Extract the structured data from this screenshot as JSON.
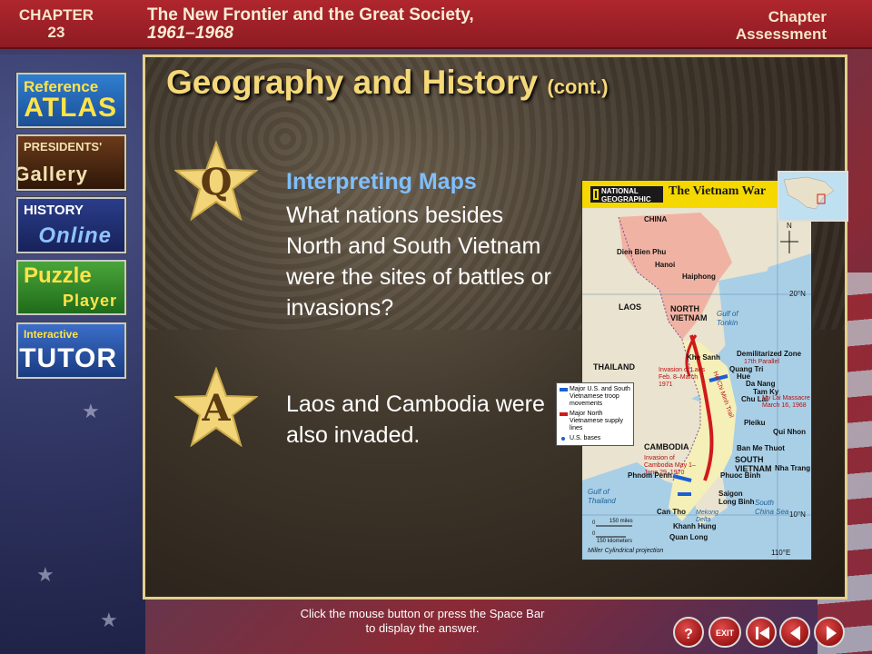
{
  "header": {
    "chapter_label": "CHAPTER",
    "chapter_number": "23",
    "title": "The New Frontier and the Great Society,",
    "years": "1961–1968",
    "assessment_line1": "Chapter",
    "assessment_line2": "Assessment"
  },
  "nav": {
    "atlas": {
      "line1": "Reference",
      "line2": "ATLAS"
    },
    "presidents": {
      "line1": "PRESIDENTS'",
      "line2": "Gallery"
    },
    "history": {
      "line1": "HISTORY",
      "line2": "Online"
    },
    "puzzle": {
      "line1": "Puzzle",
      "line2": "Player"
    },
    "tutor": {
      "line1": "Interactive",
      "line2": "TUTOR"
    }
  },
  "slide": {
    "title": "Geography and History",
    "title_suffix": "(cont.)",
    "q_letter": "Q",
    "a_letter": "A",
    "question_heading": "Interpreting Maps",
    "question_text": "What nations besides North and South Vietnam were the sites of battles or invasions?",
    "answer_text": "Laos and Cambodia were also invaded."
  },
  "map": {
    "publisher": "NATIONAL GEOGRAPHIC",
    "title": "The Vietnam War",
    "labels": {
      "china": "CHINA",
      "dien_bien_phu": "Dien Bien Phu",
      "hanoi": "Hanoi",
      "haiphong": "Haiphong",
      "laos": "LAOS",
      "north_vietnam": "NORTH VIETNAM",
      "gulf_tonkin": "Gulf of Tonkin",
      "dmz": "Demilitarized Zone",
      "parallel": "17th Parallel",
      "khe_sanh": "Khe Sanh",
      "quang_tri": "Quang Tri",
      "hue": "Hue",
      "da_nang": "Da Nang",
      "tam_ky": "Tam Ky",
      "chu_lai": "Chu Lai",
      "my_lai": "My Lai Massacre March 16, 1968",
      "laos_invasion": "Invasion of Laos Feb. 8–March 1971",
      "thailand": "THAILAND",
      "pleiku": "Pleiku",
      "qui_nhon": "Qui Nhon",
      "ban_me_thuot": "Ban Me Thuot",
      "cambodia": "CAMBODIA",
      "south_vietnam": "SOUTH VIETNAM",
      "nha_trang": "Nha Trang",
      "cambodia_invasion": "Invasion of Cambodia May 1–June 29, 1970",
      "phnom_penh": "Phnom Penh",
      "phuoc_binh": "Phuoc Binh",
      "saigon": "Saigon",
      "long_binh": "Long Binh",
      "gulf_thailand": "Gulf of Thailand",
      "can_tho": "Can Tho",
      "mekong_delta": "Mekong Delta",
      "khanh_hung": "Khanh Hung",
      "quan_long": "Quan Long",
      "south_china_sea": "South China Sea",
      "ho_chi_minh_trail": "Ho Chi Minh Trail",
      "lat_20": "20°N",
      "lat_10": "10°N",
      "lon_110": "110°E",
      "scale_miles": "150 miles",
      "scale_km": "150 kilometers",
      "scale_zero_a": "0",
      "scale_zero_b": "0",
      "projection": "Miller Cylindrical projection",
      "compass": "N"
    },
    "legend": [
      {
        "text": "Major U.S. and South Vietnamese troop movements",
        "color": "#1b5fd1"
      },
      {
        "text": "Major North Vietnamese supply lines",
        "color": "#d01a1a"
      },
      {
        "text": "U.S. bases",
        "color": "#1b5fd1"
      }
    ]
  },
  "footer": {
    "hint": "Click the mouse button or press the Space Bar to display the answer.",
    "help": "?",
    "exit": "EXIT"
  }
}
